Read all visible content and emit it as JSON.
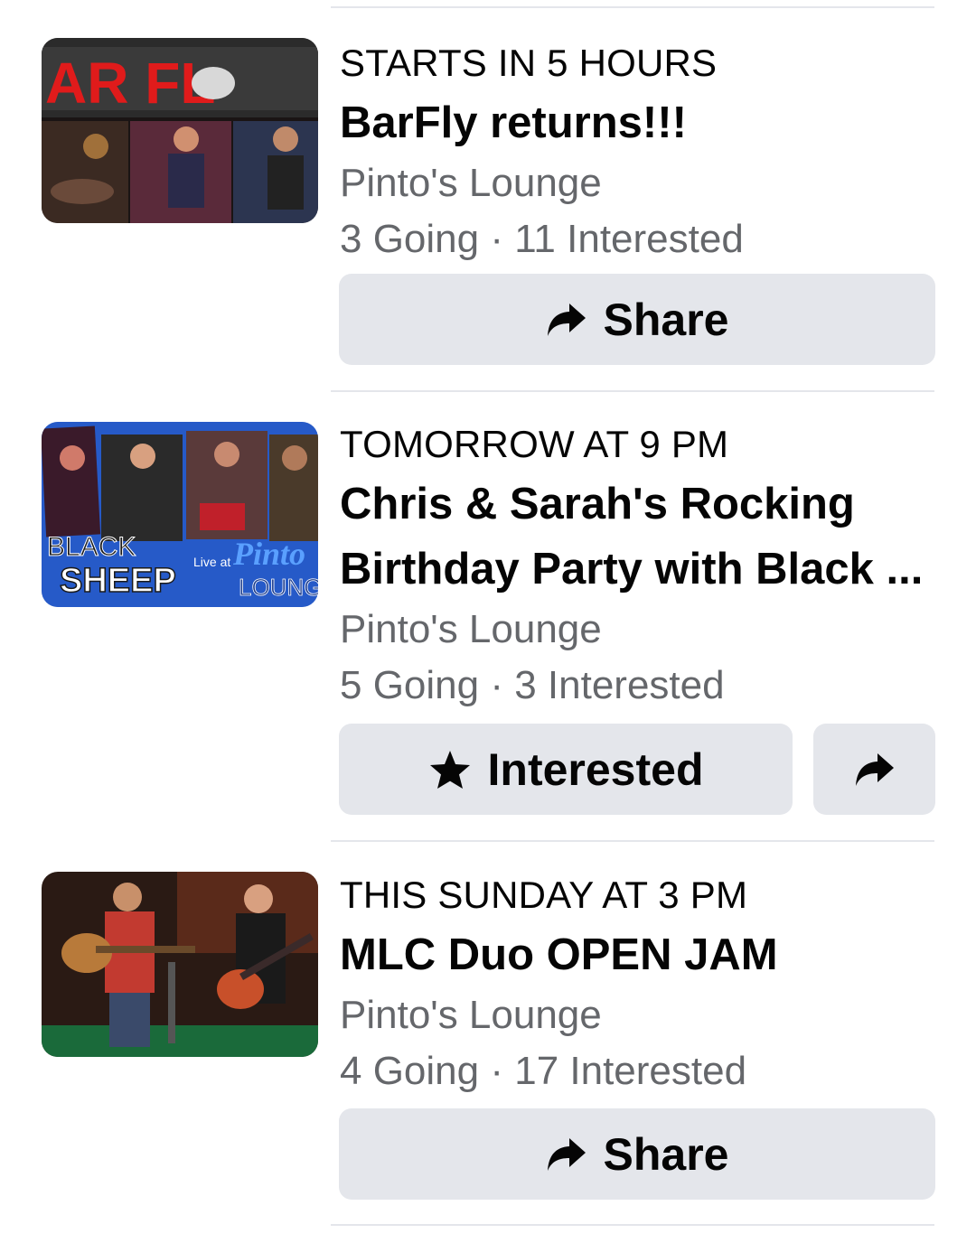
{
  "events": [
    {
      "when": "STARTS IN 5 HOURS",
      "title_lines": [
        "BarFly returns!!!"
      ],
      "location": "Pinto's Lounge",
      "going": "3 Going",
      "interested": "11 Interested",
      "stats_sep": " · ",
      "image_text": "AR FL",
      "button_label": "Share",
      "button_icon": "share-icon"
    },
    {
      "when": "TOMORROW AT 9 PM",
      "title_lines": [
        "Chris & Sarah's Rocking",
        "Birthday Party with Black ..."
      ],
      "location": "Pinto's Lounge",
      "going": "5 Going",
      "interested": "3 Interested",
      "stats_sep": " · ",
      "image_text_1": "BLACK",
      "image_text_2": "SHEEP",
      "image_text_3": "Live at",
      "image_text_4": "Pinto",
      "image_text_5": "LOUNG",
      "button_label": "Interested",
      "button_icon": "star-icon",
      "secondary_icon": "share-icon"
    },
    {
      "when": "THIS SUNDAY AT 3 PM",
      "title_lines": [
        "MLC Duo OPEN JAM"
      ],
      "location": "Pinto's Lounge",
      "going": "4 Going",
      "interested": "17 Interested",
      "stats_sep": " · ",
      "button_label": "Share",
      "button_icon": "share-icon"
    }
  ],
  "colors": {
    "text_primary": "#050505",
    "text_secondary": "#65676b",
    "button_bg": "#e4e6eb",
    "divider": "#e4e6eb"
  }
}
